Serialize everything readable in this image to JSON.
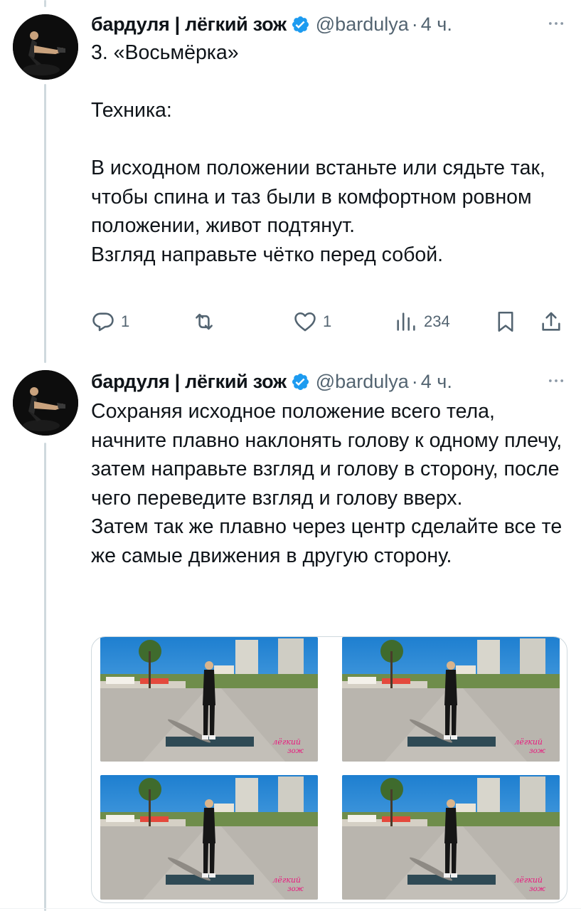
{
  "tweets": [
    {
      "author": {
        "name": "бардуля | лёгкий зож",
        "handle": "@bardulya",
        "separator": "·",
        "time": "4 ч."
      },
      "text": "3. «Восьмёрка»\n\nТехника:\n\nВ исходном положении встаньте или сядьте так, чтобы спина и таз были в комфортном ровном положении, живот подтянут.\nВзгляд направьте чётко перед собой.",
      "stats": {
        "replies": "1",
        "likes": "1",
        "views": "234"
      }
    },
    {
      "author": {
        "name": "бардуля | лёгкий зож",
        "handle": "@bardulya",
        "separator": "·",
        "time": "4 ч."
      },
      "text": "Сохраняя исходное положение всего тела, начните плавно наклонять голову к одному плечу, затем направьте взгляд и голову в сторону, после чего переведите взгляд и голову вверх.\nЗатем так же плавно через центр сделайте все те же самые движения в другую сторону.",
      "media": [
        {
          "watermark": "лёгкий зож"
        },
        {
          "watermark": "лёгкий зож"
        },
        {
          "watermark": "лёгкий зож"
        },
        {
          "watermark": "лёгкий зож"
        }
      ]
    }
  ],
  "icons": {
    "verified": "verified-badge-icon",
    "more": "more-icon",
    "reply": "reply-icon",
    "retweet": "retweet-icon",
    "like": "like-icon",
    "views": "views-icon",
    "bookmark": "bookmark-icon",
    "share": "share-icon"
  },
  "colors": {
    "text": "#0f1419",
    "secondary": "#536471",
    "verified": "#1d9bf0",
    "thread_line": "#cfd9de",
    "watermark": "#e8197d"
  }
}
